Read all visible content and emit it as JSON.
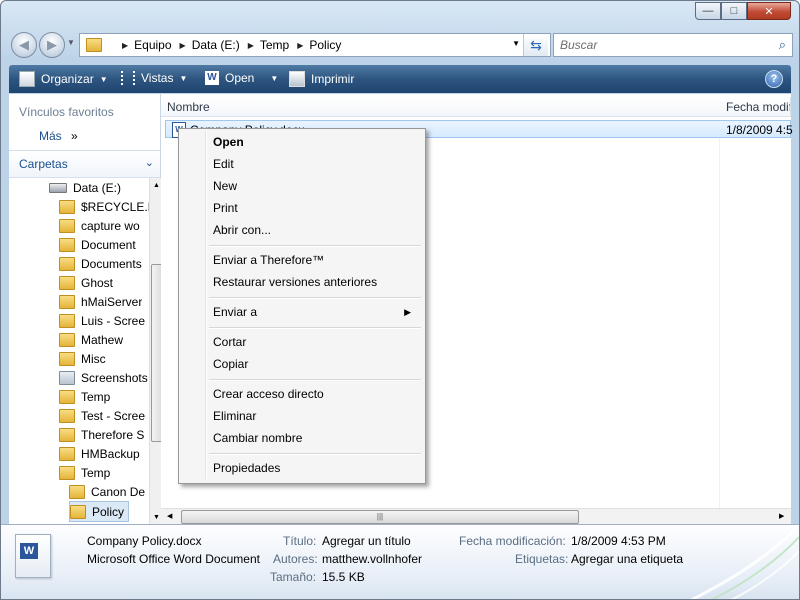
{
  "window": {
    "minimize": "—",
    "maximize": "□",
    "close": "✕"
  },
  "address": {
    "breadcrumb": [
      "Equipo",
      "Data (E:)",
      "Temp",
      "Policy"
    ],
    "search_placeholder": "Buscar"
  },
  "toolbar": {
    "organize": "Organizar",
    "views": "Vistas",
    "open": "Open",
    "print": "Imprimir"
  },
  "sidebar": {
    "favorites_title": "Vínculos favoritos",
    "more": "Más",
    "folders_title": "Carpetas",
    "tree": [
      {
        "label": "Data (E:)",
        "type": "drive"
      },
      {
        "label": "$RECYCLE.E",
        "type": "folder"
      },
      {
        "label": "capture wo",
        "type": "folder"
      },
      {
        "label": "Document",
        "type": "folder"
      },
      {
        "label": "Documents",
        "type": "folder"
      },
      {
        "label": "Ghost",
        "type": "folder"
      },
      {
        "label": "hMaiServer",
        "type": "folder"
      },
      {
        "label": "Luis - Scree",
        "type": "folder"
      },
      {
        "label": "Mathew",
        "type": "folder"
      },
      {
        "label": "Misc",
        "type": "folder"
      },
      {
        "label": "Screenshots",
        "type": "special"
      },
      {
        "label": "Temp",
        "type": "folder"
      },
      {
        "label": "Test - Scree",
        "type": "folder"
      },
      {
        "label": "Therefore S",
        "type": "folder"
      },
      {
        "label": "HMBackup",
        "type": "folder"
      },
      {
        "label": "Temp",
        "type": "folder"
      },
      {
        "label": "Canon De",
        "type": "folder"
      },
      {
        "label": "Policy",
        "type": "folder"
      }
    ]
  },
  "filelist": {
    "columns": [
      "Nombre",
      "Fecha modif"
    ],
    "rows": [
      {
        "name": "Company Policy.docx",
        "date": "1/8/2009 4:5"
      }
    ]
  },
  "context_menu": {
    "items": [
      {
        "label": "Open",
        "bold": true
      },
      {
        "label": "Edit"
      },
      {
        "label": "New"
      },
      {
        "label": "Print"
      },
      {
        "label": "Abrir con..."
      },
      {
        "label": "Enviar a Therefore™"
      },
      {
        "label": "Restaurar versiones anteriores"
      },
      {
        "label": "Enviar a"
      },
      {
        "label": "Cortar"
      },
      {
        "label": "Copiar"
      },
      {
        "label": "Crear acceso directo"
      },
      {
        "label": "Eliminar"
      },
      {
        "label": "Cambiar nombre"
      },
      {
        "label": "Propiedades"
      }
    ]
  },
  "details": {
    "filename": "Company Policy.docx",
    "filetype": "Microsoft Office Word Document",
    "title_label": "Título:",
    "title_value": "Agregar un título",
    "authors_label": "Autores:",
    "authors_value": "matthew.vollnhofer",
    "size_label": "Tamaño:",
    "size_value": "15.5 KB",
    "modified_label": "Fecha modificación:",
    "modified_value": "1/8/2009 4:53 PM",
    "tags_label": "Etiquetas:",
    "tags_value": "Agregar una etiqueta"
  },
  "colors": {
    "command_bar": "#2d557f",
    "selection": "#d6eafe",
    "link": "#1a4f8f"
  }
}
